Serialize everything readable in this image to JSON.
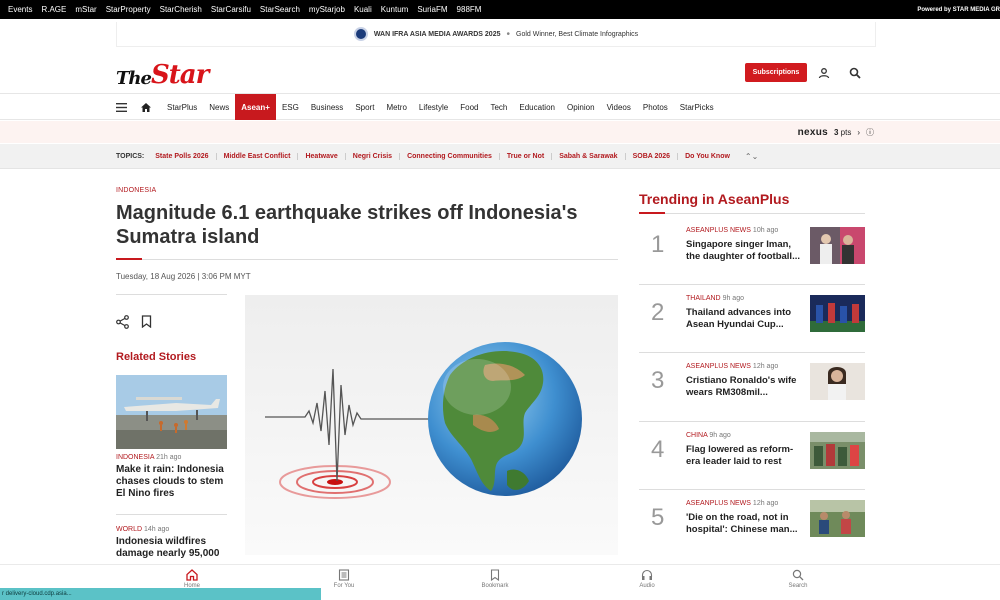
{
  "network_bar": {
    "links": [
      "Events",
      "R.AGE",
      "mStar",
      "StarProperty",
      "StarCherish",
      "StarCarsifu",
      "StarSearch",
      "myStarjob",
      "Kuali",
      "Kuntum",
      "SuriaFM",
      "988FM"
    ],
    "powered_by": "Powered by STAR MEDIA GR"
  },
  "award_banner": {
    "title": "WAN IFRA ASIA MEDIA AWARDS 2025",
    "separator": "•",
    "subtitle": "Gold Winner, Best Climate Infographics"
  },
  "header": {
    "logo_the": "The",
    "logo_star": "Star",
    "subscribe_label": "Subscriptions",
    "icons": [
      "user-icon",
      "search-icon"
    ]
  },
  "nav": {
    "items": [
      "StarPlus",
      "News",
      "Asean+",
      "ESG",
      "Business",
      "Sport",
      "Metro",
      "Lifestyle",
      "Food",
      "Tech",
      "Education",
      "Opinion",
      "Videos",
      "Photos",
      "StarPicks"
    ],
    "active": "Asean+"
  },
  "nexus": {
    "brand": "nexus",
    "points": "3",
    "points_unit": "pts",
    "arrow": "›",
    "info": "ⓘ"
  },
  "topics": {
    "label": "TOPICS:",
    "items": [
      "State Polls 2026",
      "Middle East Conflict",
      "Heatwave",
      "Negri Crisis",
      "Connecting Communities",
      "True or Not",
      "Sabah & Sarawak",
      "SOBA 2026",
      "Do You Know"
    ],
    "more": "⌃⌄"
  },
  "article": {
    "section": "INDONESIA",
    "headline": "Magnitude 6.1 earthquake strikes off Indonesia's Sumatra island",
    "date": "Tuesday, 18 Aug 2026 | 3:06 PM MYT"
  },
  "related": {
    "title": "Related Stories",
    "items": [
      {
        "tag": "INDONESIA",
        "time": "21h ago",
        "title": "Make it rain: Indonesia chases clouds to stem El Nino fires"
      },
      {
        "tag": "WORLD",
        "time": "14h ago",
        "title": "Indonesia wildfires damage nearly 95,000"
      }
    ]
  },
  "trending": {
    "title": "Trending in AseanPlus",
    "items": [
      {
        "rank": "1",
        "tag": "ASEANPLUS NEWS",
        "time": "10h ago",
        "title": "Singapore singer Iman, the daughter of football..."
      },
      {
        "rank": "2",
        "tag": "THAILAND",
        "time": "9h ago",
        "title": "Thailand advances into Asean Hyundai Cup..."
      },
      {
        "rank": "3",
        "tag": "ASEANPLUS NEWS",
        "time": "12h ago",
        "title": "Cristiano Ronaldo's wife wears RM308mil..."
      },
      {
        "rank": "4",
        "tag": "CHINA",
        "time": "9h ago",
        "title": "Flag lowered as reform-era leader laid to rest"
      },
      {
        "rank": "5",
        "tag": "ASEANPLUS NEWS",
        "time": "12h ago",
        "title": "'Die on the road, not in hospital': Chinese man..."
      }
    ]
  },
  "bottom_nav": {
    "items": [
      {
        "label": "Home",
        "icon": "home-icon"
      },
      {
        "label": "For You",
        "icon": "for-you-icon"
      },
      {
        "label": "Bookmark",
        "icon": "bookmark-icon"
      },
      {
        "label": "Audio",
        "icon": "headphones-icon"
      },
      {
        "label": "Search",
        "icon": "search-icon"
      }
    ]
  },
  "status_bar": {
    "text": "r delivery-cloud.cdp.asia..."
  },
  "colors": {
    "brand_red": "#c8191e",
    "topbar": "#000000",
    "status_teal": "#5bc2c7"
  }
}
